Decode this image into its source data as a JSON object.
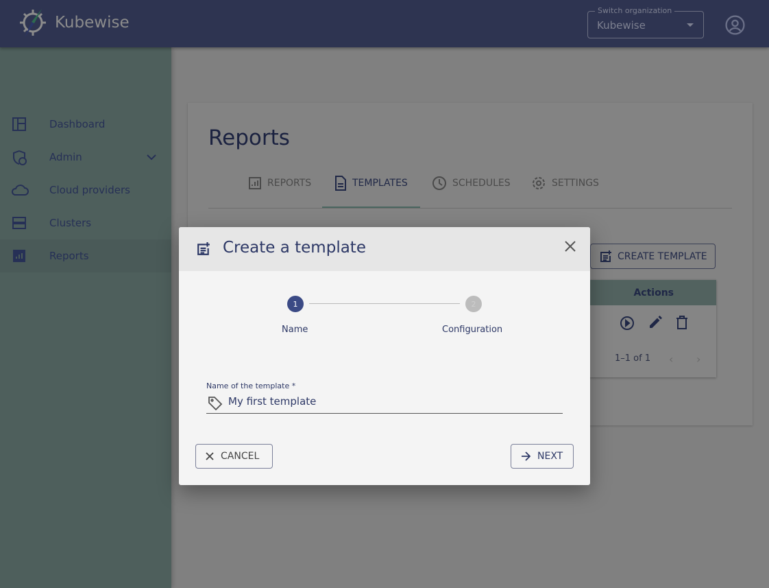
{
  "header": {
    "brand": "Kubewise",
    "org_label": "Switch organization",
    "org_value": "Kubewise"
  },
  "sidebar": {
    "items": [
      {
        "label": "Dashboard",
        "icon": "dashboard-icon"
      },
      {
        "label": "Admin",
        "icon": "admin-shield-icon"
      },
      {
        "label": "Cloud providers",
        "icon": "cloud-icon"
      },
      {
        "label": "Clusters",
        "icon": "server-icon"
      },
      {
        "label": "Reports",
        "icon": "reports-icon",
        "active": true
      }
    ]
  },
  "main": {
    "title": "Reports",
    "tabs": [
      {
        "label": "REPORTS"
      },
      {
        "label": "TEMPLATES",
        "active": true
      },
      {
        "label": "SCHEDULES"
      },
      {
        "label": "SETTINGS"
      }
    ],
    "create_button": "CREATE TEMPLATE",
    "table": {
      "header": "Actions",
      "pagination": "1–1 of 1"
    }
  },
  "dialog": {
    "title": "Create a template",
    "steps": [
      {
        "num": "1",
        "label": "Name",
        "active": true
      },
      {
        "num": "2",
        "label": "Configuration"
      }
    ],
    "field_label": "Name of the template *",
    "field_value": "My first template",
    "cancel": "CANCEL",
    "next": "NEXT"
  },
  "colors": {
    "header": "#2e3451",
    "accent": "#3b4a85",
    "sidebar": "#4e5f5c"
  }
}
